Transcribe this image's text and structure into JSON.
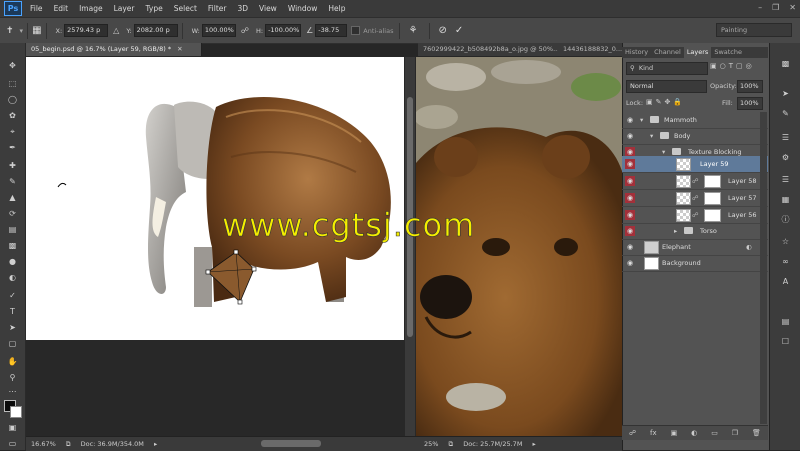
{
  "app": {
    "logo": "Ps"
  },
  "menu": [
    "File",
    "Edit",
    "Image",
    "Layer",
    "Type",
    "Select",
    "Filter",
    "3D",
    "View",
    "Window",
    "Help"
  ],
  "options": {
    "x_label": "X:",
    "x_value": "2579.43 p",
    "y_label": "Y:",
    "y_value": "2082.00 p",
    "w_label": "W:",
    "w_value": "100.00%",
    "h_label": "H:",
    "h_value": "-100.00%",
    "angle_value": "-38.75",
    "antialias_label": "Anti-alias",
    "workspace": "Painting"
  },
  "tabs": {
    "doc1": "05_begin.psd @ 16.7% (Layer 59, RGB/8) *",
    "doc2": "7602999422_b508492b8a_o.jpg @ 50%...",
    "doc3": "14436188832_0..."
  },
  "status": {
    "doc1_zoom": "16.67%",
    "doc1_info": "Doc: 36.9M/354.0M",
    "doc2_zoom": "25%",
    "doc2_info": "Doc: 25.7M/25.7M"
  },
  "panel": {
    "tabs": [
      "History",
      "Channel",
      "Layers",
      "Swatche"
    ],
    "filter_kind": "Kind",
    "blend_mode": "Normal",
    "opacity_label": "Opacity:",
    "opacity_value": "100%",
    "lock_label": "Lock:",
    "fill_label": "Fill:",
    "fill_value": "100%",
    "layers": [
      "Mammoth",
      "Body",
      "Texture Blocking",
      "Layer 59",
      "Layer 58",
      "Layer 57",
      "Layer 56",
      "Torso",
      "Elephant",
      "Background"
    ]
  },
  "watermark": "www.cgtsj.com"
}
